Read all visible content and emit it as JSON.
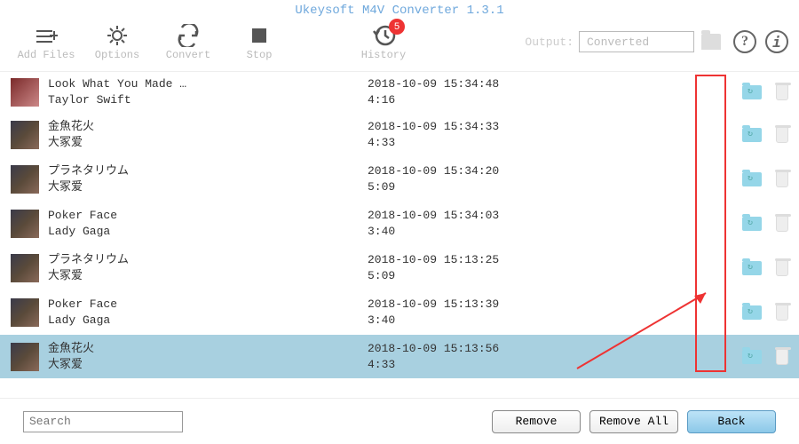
{
  "title": "Ukeysoft M4V Converter 1.3.1",
  "toolbar": {
    "add_files": "Add Files",
    "options": "Options",
    "convert": "Convert",
    "stop": "Stop",
    "history": "History",
    "history_badge": "5",
    "output_label": "Output:",
    "output_value": "Converted"
  },
  "tracks": [
    {
      "title": "Look What You Made …",
      "artist": "Taylor Swift",
      "datetime": "2018-10-09 15:34:48",
      "duration": "4:16",
      "selected": false
    },
    {
      "title": "金魚花火",
      "artist": "大冢爱",
      "datetime": "2018-10-09 15:34:33",
      "duration": "4:33",
      "selected": false
    },
    {
      "title": "プラネタリウム",
      "artist": "大冢爱",
      "datetime": "2018-10-09 15:34:20",
      "duration": "5:09",
      "selected": false
    },
    {
      "title": "Poker Face",
      "artist": "Lady Gaga",
      "datetime": "2018-10-09 15:34:03",
      "duration": "3:40",
      "selected": false
    },
    {
      "title": "プラネタリウム",
      "artist": "大冢爱",
      "datetime": "2018-10-09 15:13:25",
      "duration": "5:09",
      "selected": false
    },
    {
      "title": "Poker Face",
      "artist": "Lady Gaga",
      "datetime": "2018-10-09 15:13:39",
      "duration": "3:40",
      "selected": false
    },
    {
      "title": "金魚花火",
      "artist": "大冢爱",
      "datetime": "2018-10-09 15:13:56",
      "duration": "4:33",
      "selected": true
    }
  ],
  "footer": {
    "search_placeholder": "Search",
    "remove": "Remove",
    "remove_all": "Remove All",
    "back": "Back"
  }
}
